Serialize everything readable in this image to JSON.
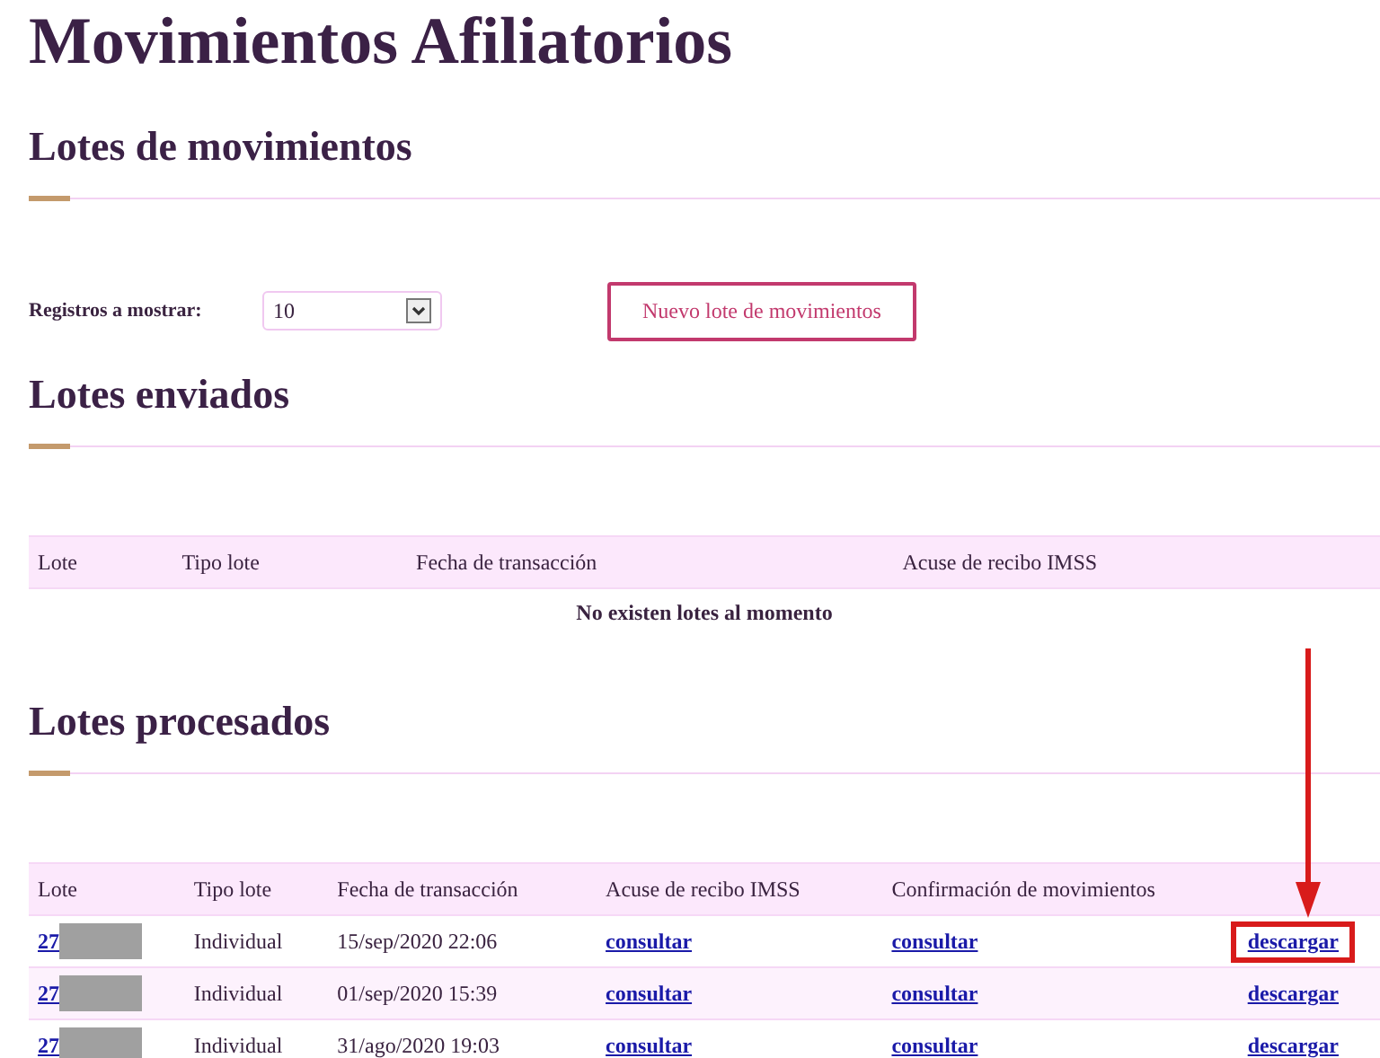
{
  "title": "Movimientos Afiliatorios",
  "movimientos": {
    "heading": "Lotes de movimientos",
    "records_label": "Registros a mostrar:",
    "records_value": "10",
    "new_button": "Nuevo lote de movimientos"
  },
  "enviados": {
    "heading": "Lotes enviados",
    "columns": [
      "Lote",
      "Tipo lote",
      "Fecha de transacción",
      "Acuse de recibo IMSS"
    ],
    "empty_message": "No existen lotes al momento"
  },
  "procesados": {
    "heading": "Lotes procesados",
    "columns": [
      "Lote",
      "Tipo lote",
      "Fecha de transacción",
      "Acuse de recibo IMSS",
      "Confirmación de movimientos"
    ],
    "rows": [
      {
        "lote": "27",
        "tipo": "Individual",
        "fecha": "15/sep/2020 22:06",
        "acuse": "consultar",
        "confirmacion": "consultar",
        "descarga": "descargar",
        "highlighted": true
      },
      {
        "lote": "27",
        "tipo": "Individual",
        "fecha": "01/sep/2020 15:39",
        "acuse": "consultar",
        "confirmacion": "consultar",
        "descarga": "descargar",
        "highlighted": false
      },
      {
        "lote": "27",
        "tipo": "Individual",
        "fecha": "31/ago/2020 19:03",
        "acuse": "consultar",
        "confirmacion": "consultar",
        "descarga": "descargar",
        "highlighted": false
      }
    ]
  }
}
